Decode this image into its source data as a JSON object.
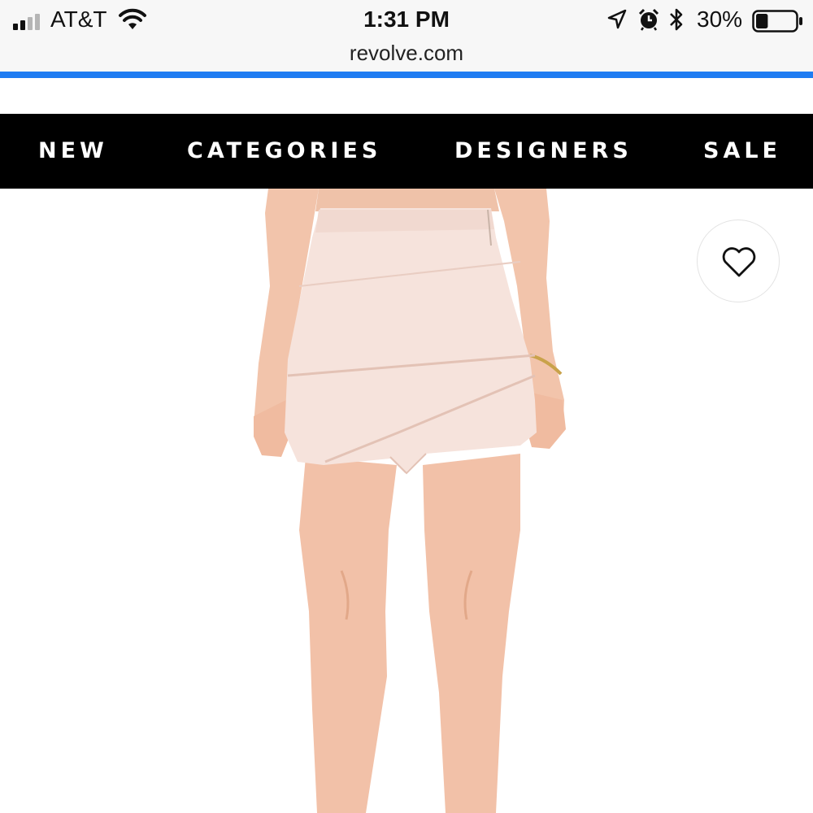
{
  "status_bar": {
    "carrier": "AT&T",
    "time": "1:31 PM",
    "battery_percent": "30%",
    "battery_level": 0.3,
    "icons": [
      "signal-icon",
      "wifi-icon",
      "location-icon",
      "alarm-icon",
      "bluetooth-icon",
      "battery-icon"
    ]
  },
  "browser": {
    "url": "revolve.com",
    "load_progress": 1.0,
    "accent_color": "#1e7cf2"
  },
  "nav": {
    "items": [
      {
        "label": "NEW"
      },
      {
        "label": "CATEGORIES"
      },
      {
        "label": "DESIGNERS"
      },
      {
        "label": "SALE"
      }
    ]
  },
  "product": {
    "image_icon": "product-photo",
    "wishlist_icon": "heart-icon",
    "colors": {
      "skirt": "#f6e3dc",
      "skin": "#f2c1a8"
    }
  }
}
